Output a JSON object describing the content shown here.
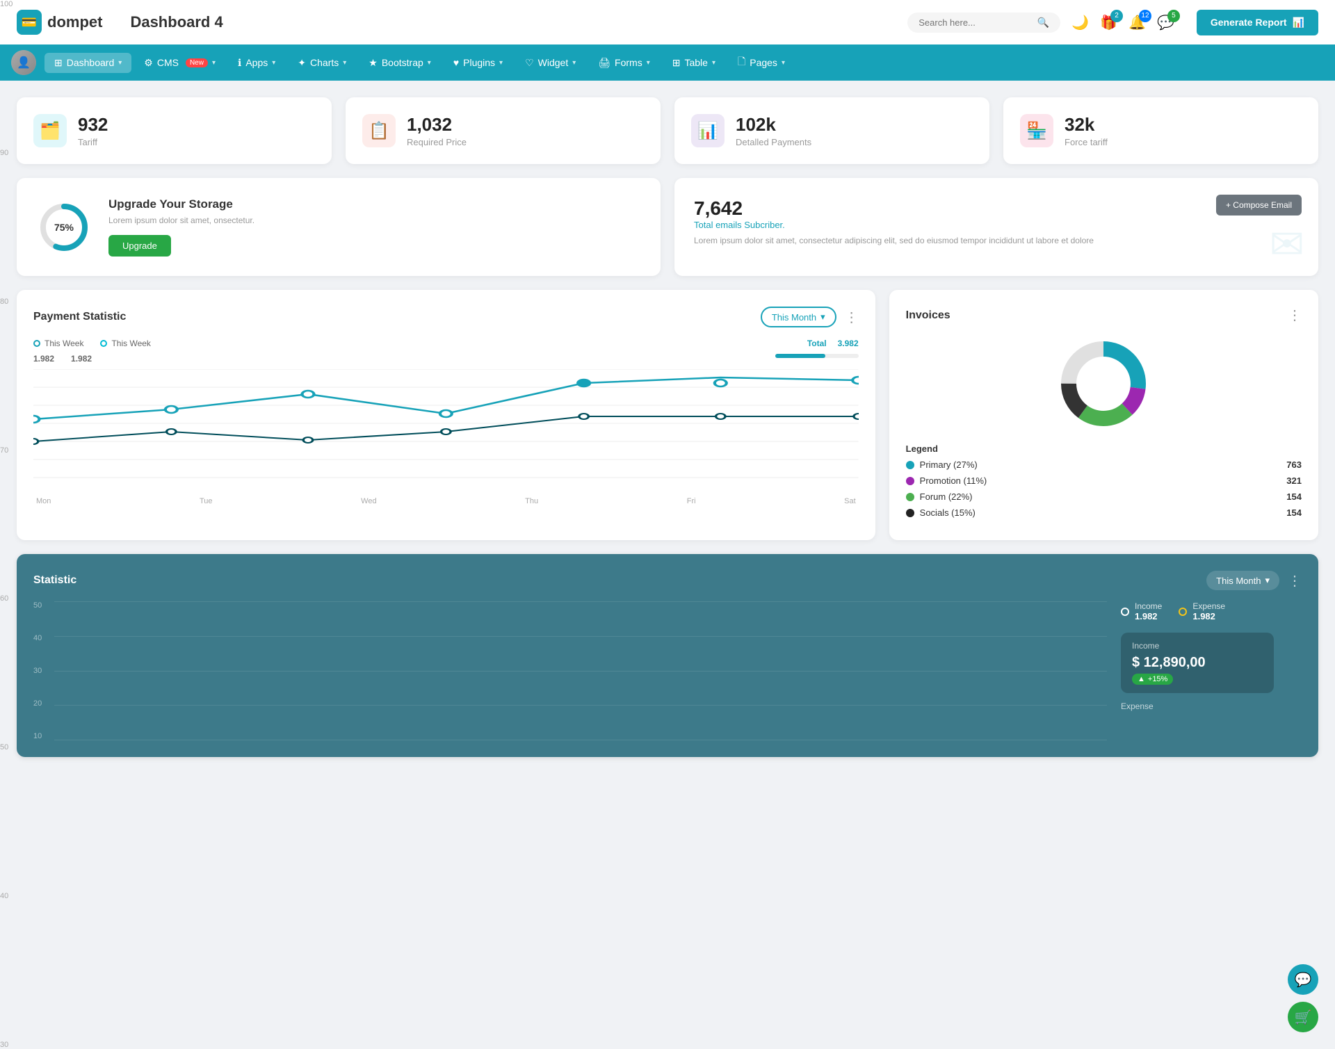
{
  "header": {
    "logo_icon": "💳",
    "logo_name": "dompet",
    "page_title": "Dashboard 4",
    "search_placeholder": "Search here...",
    "icons": {
      "moon": "🌙",
      "gift": "🎁",
      "bell": "🔔",
      "chat": "💬"
    },
    "badges": {
      "gift": "2",
      "bell": "12",
      "chat": "5"
    },
    "generate_btn": "Generate Report"
  },
  "navbar": {
    "items": [
      {
        "id": "dashboard",
        "label": "Dashboard",
        "active": true,
        "has_chevron": true
      },
      {
        "id": "cms",
        "label": "CMS",
        "badge": "New",
        "has_chevron": true
      },
      {
        "id": "apps",
        "label": "Apps",
        "has_chevron": true
      },
      {
        "id": "charts",
        "label": "Charts",
        "has_chevron": true
      },
      {
        "id": "bootstrap",
        "label": "Bootstrap",
        "has_chevron": true
      },
      {
        "id": "plugins",
        "label": "Plugins",
        "has_chevron": true
      },
      {
        "id": "widget",
        "label": "Widget",
        "has_chevron": true
      },
      {
        "id": "forms",
        "label": "Forms",
        "has_chevron": true
      },
      {
        "id": "table",
        "label": "Table",
        "has_chevron": true
      },
      {
        "id": "pages",
        "label": "Pages",
        "has_chevron": true
      }
    ]
  },
  "stats": [
    {
      "icon": "🗂️",
      "icon_color": "#17a2b8",
      "number": "932",
      "label": "Tariff"
    },
    {
      "icon": "📋",
      "icon_color": "#dc3545",
      "number": "1,032",
      "label": "Required Price"
    },
    {
      "icon": "📊",
      "icon_color": "#6f42c1",
      "number": "102k",
      "label": "Detalled Payments"
    },
    {
      "icon": "🏪",
      "icon_color": "#e83e8c",
      "number": "32k",
      "label": "Force tariff"
    }
  ],
  "storage": {
    "percent": "75%",
    "percent_num": 75,
    "title": "Upgrade Your Storage",
    "desc": "Lorem ipsum dolor sit amet, onsectetur.",
    "btn_label": "Upgrade"
  },
  "email": {
    "number": "7,642",
    "sub_label": "Total emails Subcriber.",
    "desc": "Lorem ipsum dolor sit amet, consectetur adipiscing elit, sed do eiusmod tempor incididunt ut labore et dolore",
    "compose_btn": "+ Compose Email"
  },
  "payment": {
    "title": "Payment Statistic",
    "filter": "This Month",
    "legend": [
      {
        "label": "This Week",
        "value": "1.982",
        "color": "#17a2b8"
      },
      {
        "label": "This Week",
        "value": "1.982",
        "color": "#00bcd4"
      }
    ],
    "total_label": "Total",
    "total_value": "3.982",
    "progress": 60,
    "x_labels": [
      "Mon",
      "Tue",
      "Wed",
      "Thu",
      "Fri",
      "Sat"
    ],
    "y_labels": [
      "100",
      "90",
      "80",
      "70",
      "60",
      "50",
      "40",
      "30"
    ]
  },
  "invoices": {
    "title": "Invoices",
    "legend": [
      {
        "label": "Primary (27%)",
        "value": "763",
        "color": "#17a2b8"
      },
      {
        "label": "Promotion (11%)",
        "value": "321",
        "color": "#9c27b0"
      },
      {
        "label": "Forum (22%)",
        "value": "154",
        "color": "#4caf50"
      },
      {
        "label": "Socials (15%)",
        "value": "154",
        "color": "#222"
      }
    ]
  },
  "statistic": {
    "title": "Statistic",
    "filter": "This Month",
    "y_labels": [
      "50",
      "40",
      "30",
      "20",
      "10"
    ],
    "income": {
      "legend_label": "Income",
      "legend_value": "1.982",
      "box_label": "Income",
      "amount": "$ 12,890,00",
      "badge": "+15%"
    },
    "expense": {
      "legend_label": "Expense",
      "legend_value": "1.982",
      "box_label": "Expense"
    }
  }
}
